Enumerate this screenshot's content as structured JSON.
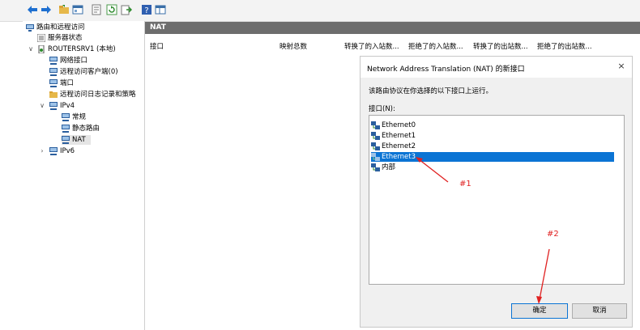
{
  "tree": {
    "root": "路由和远程访问",
    "server_status": "服务器状态",
    "server": "ROUTERSRV1 (本地)",
    "net_if": "网络接口",
    "remote_clients": "远程访问客户端(0)",
    "ports": "端口",
    "logging": "远程访问日志记录和策略",
    "ipv4": "IPv4",
    "general": "常规",
    "static_routes": "静态路由",
    "nat": "NAT",
    "ipv6": "IPv6"
  },
  "pane": {
    "title": "NAT",
    "columns": [
      "接口",
      "映射总数",
      "转换了的入站数...",
      "拒绝了的入站数...",
      "转换了的出站数...",
      "拒绝了的出站数..."
    ]
  },
  "dialog": {
    "title": "Network Address Translation (NAT) 的新接口",
    "close": "×",
    "description": "该路由协议在你选择的以下接口上运行。",
    "list_label": "接口(N):",
    "interfaces": [
      "Ethernet0",
      "Ethernet1",
      "Ethernet2",
      "Ethernet3",
      "内部"
    ],
    "selected_index": 3,
    "ok": "确定",
    "cancel": "取消"
  },
  "annotations": {
    "a1": "#1",
    "a2": "#2",
    "color": "#e02020"
  }
}
